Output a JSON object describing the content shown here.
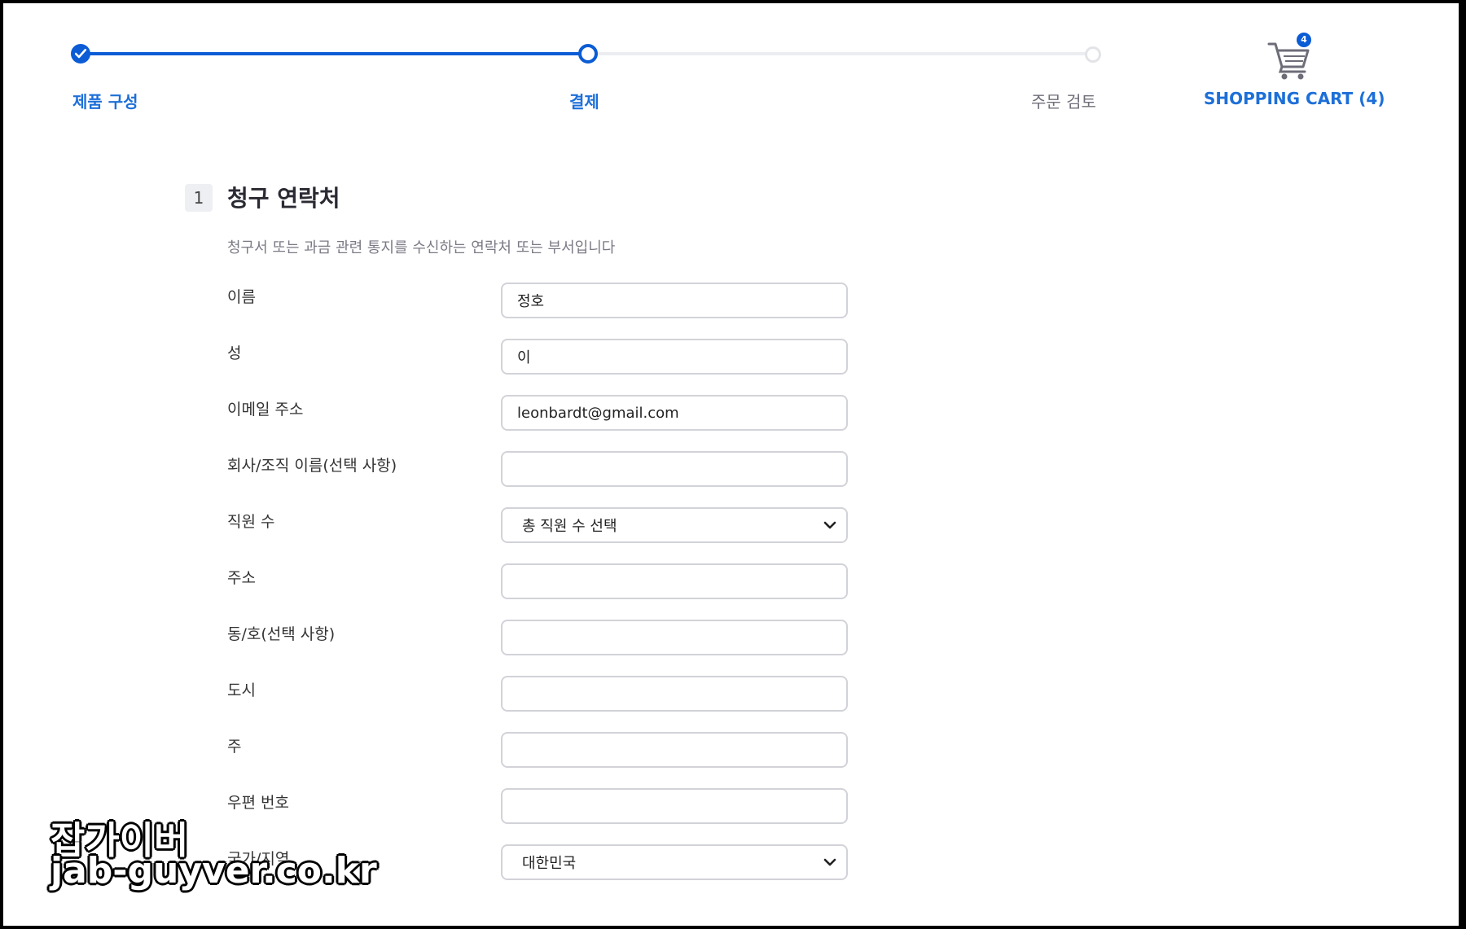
{
  "stepper": {
    "steps": [
      {
        "label": "제품 구성",
        "state": "done"
      },
      {
        "label": "결제",
        "state": "current"
      },
      {
        "label": "주문 검토",
        "state": "todo"
      }
    ],
    "cart": {
      "label": "SHOPPING CART (4)",
      "badge": "4",
      "icon": "shopping-cart-icon"
    }
  },
  "section": {
    "number": "1",
    "title": "청구 연락처",
    "description": "청구서 또는 과금 관련 통지를 수신하는 연락처 또는 부서입니다"
  },
  "fields": [
    {
      "label": "이름",
      "value": "정호",
      "type": "text"
    },
    {
      "label": "성",
      "value": "이",
      "type": "text"
    },
    {
      "label": "이메일 주소",
      "value": "leonbardt@gmail.com",
      "type": "text"
    },
    {
      "label": "회사/조직 이름(선택 사항)",
      "value": "",
      "type": "text"
    },
    {
      "label": "직원 수",
      "value": "총 직원 수 선택",
      "type": "select"
    },
    {
      "label": "주소",
      "value": "",
      "type": "text"
    },
    {
      "label": "동/호(선택 사항)",
      "value": "",
      "type": "text"
    },
    {
      "label": "도시",
      "value": "",
      "type": "text"
    },
    {
      "label": "주",
      "value": "",
      "type": "text"
    },
    {
      "label": "우편 번호",
      "value": "",
      "type": "text"
    },
    {
      "label": "국가/지역",
      "value": "대한민국",
      "type": "select"
    }
  ],
  "watermark": {
    "line1": "잡가이버",
    "line2": "jab-guyver.co.kr"
  },
  "colors": {
    "accent": "#0b5cd5",
    "link": "#1d6fd8",
    "inactive_track": "#ecedf1"
  }
}
